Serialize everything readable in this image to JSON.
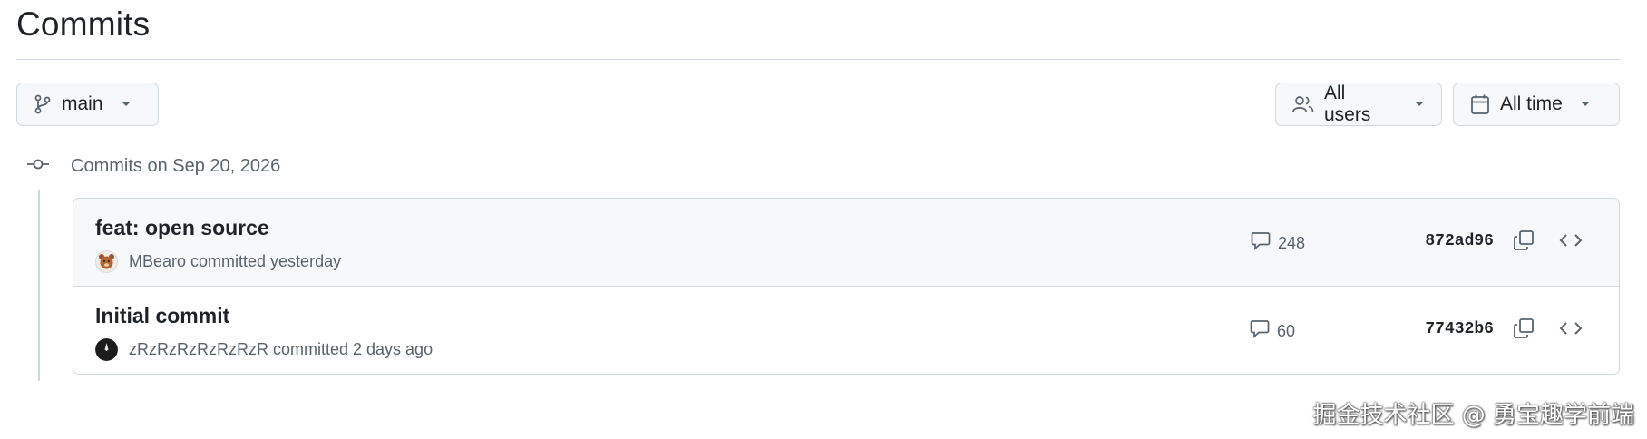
{
  "page": {
    "title": "Commits"
  },
  "filters": {
    "branch": {
      "label": "main",
      "icon": "git-branch-icon"
    },
    "users": {
      "label": "All users",
      "icon": "people-icon"
    },
    "time": {
      "label": "All time",
      "icon": "calendar-icon"
    }
  },
  "commit_groups": [
    {
      "heading": "Commits on Sep 20, 2026",
      "commits": [
        {
          "message": "feat: open source",
          "author": "MBearo",
          "committed_text": "MBearo committed yesterday",
          "comments": "248",
          "sha": "872ad96",
          "highlighted": true
        },
        {
          "message": "Initial commit",
          "author": "zRzRzRzRzRzRzR",
          "committed_text": "zRzRzRzRzRzRzR committed 2 days ago",
          "comments": "60",
          "sha": "77432b6",
          "highlighted": false
        }
      ]
    }
  ],
  "watermark": "掘金技术社区 @ 勇宝趣学前端",
  "colors": {
    "border": "#d0d7de",
    "muted": "#59636e",
    "text": "#1f2328",
    "button_bg": "#f6f8fa"
  }
}
